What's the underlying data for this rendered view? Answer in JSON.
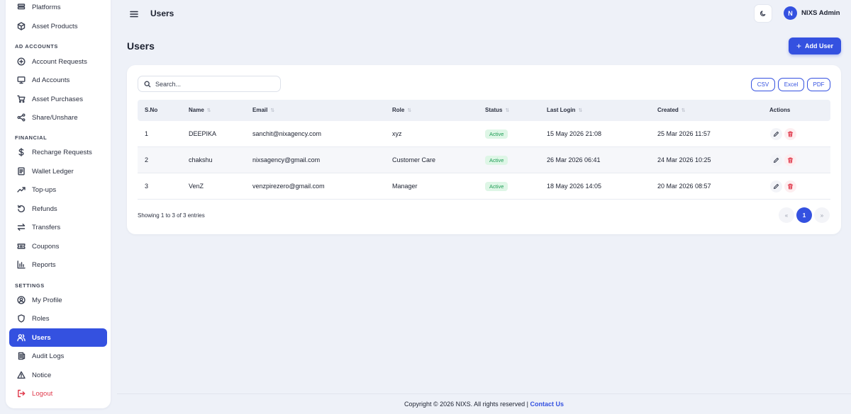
{
  "sidebar": {
    "top_items": [
      {
        "label": "Platforms",
        "icon": "layers-icon"
      },
      {
        "label": "Asset Products",
        "icon": "box-icon"
      }
    ],
    "sections": [
      {
        "label": "AD ACCOUNTS",
        "items": [
          {
            "label": "Account Requests",
            "icon": "plus-circle-icon"
          },
          {
            "label": "Ad Accounts",
            "icon": "monitor-icon"
          },
          {
            "label": "Asset Purchases",
            "icon": "cart-icon"
          },
          {
            "label": "Share/Unshare",
            "icon": "share-icon"
          }
        ]
      },
      {
        "label": "FINANCIAL",
        "items": [
          {
            "label": "Recharge Requests",
            "icon": "dollar-icon"
          },
          {
            "label": "Wallet Ledger",
            "icon": "ledger-icon"
          },
          {
            "label": "Top-ups",
            "icon": "trending-icon"
          },
          {
            "label": "Refunds",
            "icon": "refund-icon"
          },
          {
            "label": "Transfers",
            "icon": "transfer-icon"
          },
          {
            "label": "Coupons",
            "icon": "ticket-icon"
          },
          {
            "label": "Reports",
            "icon": "bar-chart-icon"
          }
        ]
      },
      {
        "label": "SETTINGS",
        "items": [
          {
            "label": "My Profile",
            "icon": "user-circle-icon"
          },
          {
            "label": "Roles",
            "icon": "shield-icon"
          },
          {
            "label": "Users",
            "icon": "users-icon",
            "active": true
          },
          {
            "label": "Audit Logs",
            "icon": "log-icon"
          },
          {
            "label": "Notice",
            "icon": "warning-icon"
          },
          {
            "label": "Logout",
            "icon": "logout-icon"
          }
        ]
      }
    ]
  },
  "header": {
    "title": "Users",
    "avatar_initial": "N",
    "user_name": "NIXS Admin"
  },
  "page": {
    "title": "Users",
    "add_button": "Add User",
    "add_button_icon": "+"
  },
  "toolbar": {
    "search_placeholder": "Search...",
    "exports": [
      "CSV",
      "Excel",
      "PDF"
    ]
  },
  "table": {
    "columns": [
      "S.No",
      "Name",
      "Email",
      "Role",
      "Status",
      "Last Login",
      "Created",
      "Actions"
    ],
    "rows": [
      {
        "sno": "1",
        "name": "DEEPIKA",
        "email": "sanchit@nixagency.com",
        "role": "xyz",
        "status": "Active",
        "last_login": "15 May 2026 21:08",
        "created": "25 Mar 2026 11:57"
      },
      {
        "sno": "2",
        "name": "chakshu",
        "email": "nixsagency@gmail.com",
        "role": "Customer Care",
        "status": "Active",
        "last_login": "26 Mar 2026 06:41",
        "created": "24 Mar 2026 10:25"
      },
      {
        "sno": "3",
        "name": "VenZ",
        "email": "venzpirezero@gmail.com",
        "role": "Manager",
        "status": "Active",
        "last_login": "18 May 2026 14:05",
        "created": "20 Mar 2026 08:57"
      }
    ],
    "info": "Showing 1 to 3 of 3 entries",
    "pagination": {
      "prev": "«",
      "current": "1",
      "next": "»"
    }
  },
  "footer": {
    "text": "Copyright © 2026 NIXS. All rights reserved |",
    "link": "Contact Us"
  },
  "colors": {
    "accent": "#3451e0",
    "danger": "#e0394b",
    "success": "#1f9d55",
    "background": "#eef1f8"
  }
}
